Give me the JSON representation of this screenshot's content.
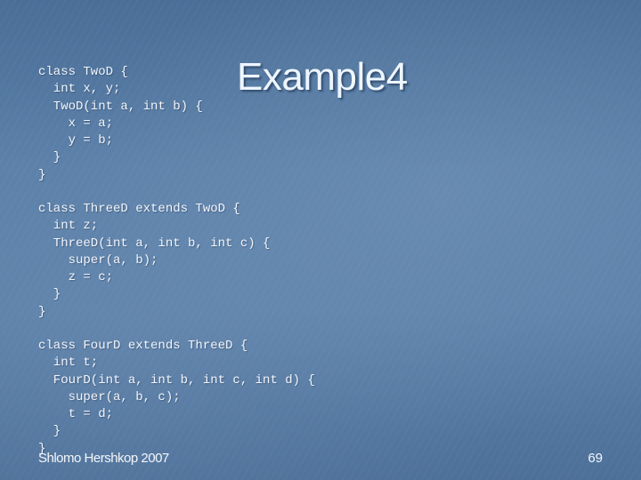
{
  "slide": {
    "title": "Example4",
    "code_blocks": [
      {
        "lines": [
          "class TwoD {",
          "  int x, y;",
          "  TwoD(int a, int b) {",
          "    x = a;",
          "    y = b;",
          "  }",
          "}"
        ]
      },
      {
        "lines": [
          "class ThreeD extends TwoD {",
          "  int z;",
          "  ThreeD(int a, int b, int c) {",
          "    super(a, b);",
          "    z = c;",
          "  }",
          "}"
        ]
      },
      {
        "lines": [
          "class FourD extends ThreeD {",
          "  int t;",
          "  FourD(int a, int b, int c, int d) {",
          "    super(a, b, c);",
          "    t = d;",
          "  }",
          "}"
        ]
      }
    ],
    "footer": {
      "author": "Shlomo Hershkop 2007",
      "page_number": "69"
    }
  }
}
